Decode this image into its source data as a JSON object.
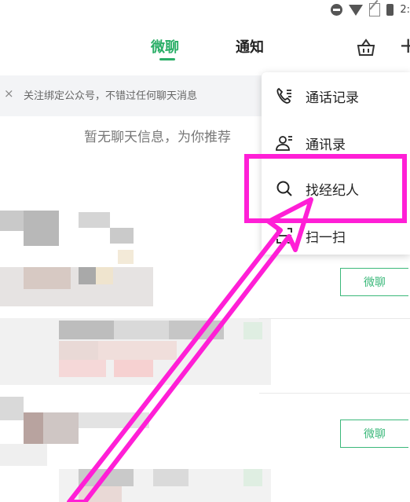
{
  "status_bar": {
    "time": "2:"
  },
  "tabs": [
    {
      "label": "微聊",
      "active": true
    },
    {
      "label": "通知",
      "active": false
    }
  ],
  "banner": {
    "close_label": "×",
    "text": "关注绑定公众号，不错过任何聊天消息"
  },
  "empty_state": {
    "text": "暂无聊天信息，为你推荐"
  },
  "list": {
    "chat_button_label": "微聊",
    "chat_button_label_2": "微聊"
  },
  "menu": {
    "items": [
      {
        "label": "通话记录",
        "icon": "phone-call-log-icon"
      },
      {
        "label": "通讯录",
        "icon": "contacts-icon"
      },
      {
        "label": "找经纪人",
        "icon": "search-icon"
      },
      {
        "label": "扫一扫",
        "icon": "scan-icon"
      }
    ]
  },
  "colors": {
    "accent": "#2aae67",
    "annotation": "#ff1fd6",
    "banner_bg": "#f3f4f6"
  }
}
